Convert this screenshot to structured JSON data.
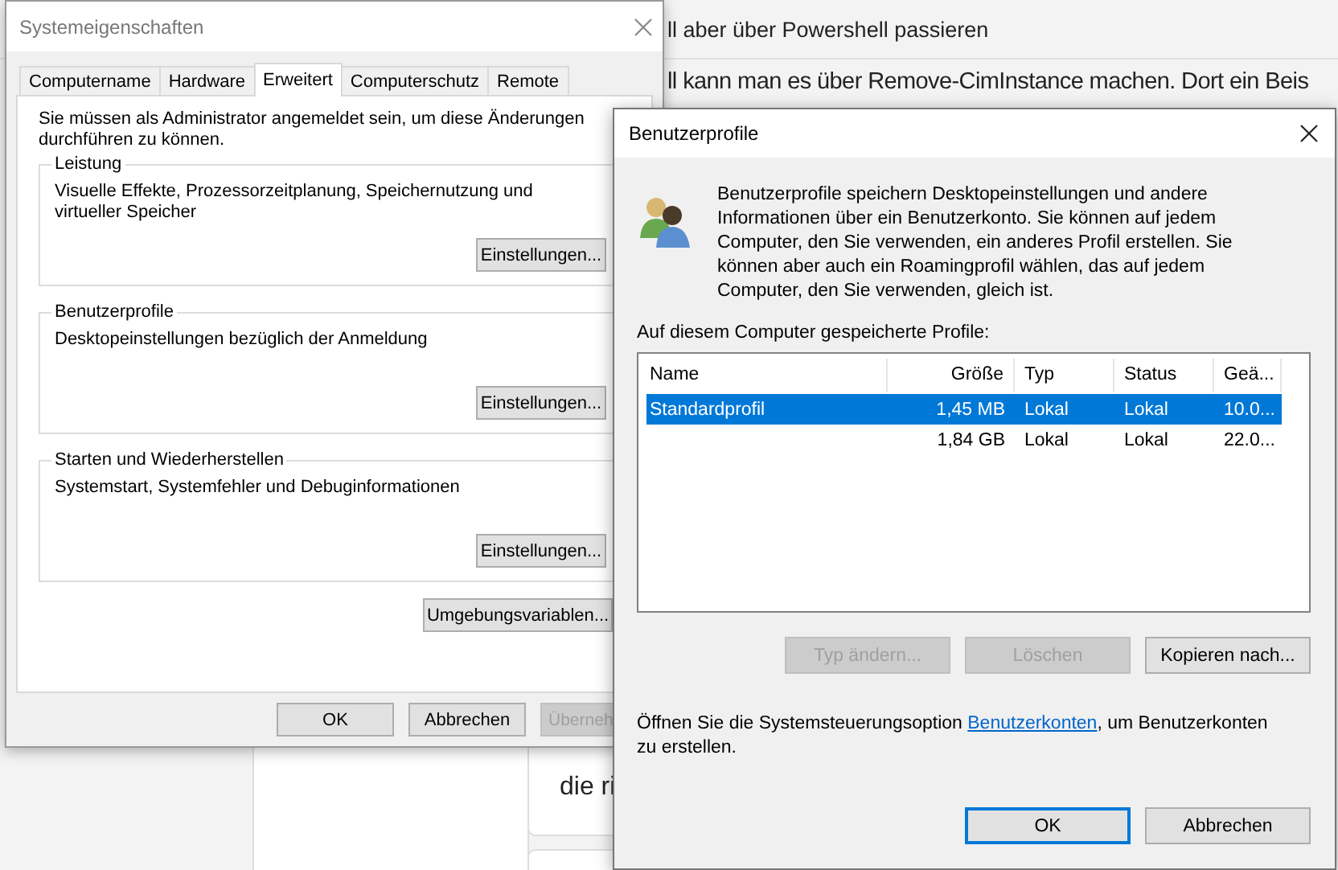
{
  "background_page": {
    "heading_fragment": "ll aber über Powershell passieren",
    "text_fragment": "ll kann man es über Remove-CimInstance machen. Dort ein Beis",
    "card_fragment": "die ri"
  },
  "system_properties": {
    "title": "Systemeigenschaften",
    "tabs": [
      {
        "label": "Computername",
        "selected": false
      },
      {
        "label": "Hardware",
        "selected": false
      },
      {
        "label": "Erweitert",
        "selected": true
      },
      {
        "label": "Computerschutz",
        "selected": false
      },
      {
        "label": "Remote",
        "selected": false
      }
    ],
    "notice": "Sie müssen als Administrator angemeldet sein, um diese Änderungen durchführen zu können.",
    "groups": [
      {
        "title": "Leistung",
        "description": "Visuelle Effekte, Prozessorzeitplanung, Speichernutzung und virtueller Speicher",
        "button": "Einstellungen..."
      },
      {
        "title": "Benutzerprofile",
        "description": "Desktopeinstellungen bezüglich der Anmeldung",
        "button": "Einstellungen..."
      },
      {
        "title": "Starten und Wiederherstellen",
        "description": "Systemstart, Systemfehler und Debuginformationen",
        "button": "Einstellungen..."
      }
    ],
    "environment_button": "Umgebungsvariablen...",
    "buttons": [
      {
        "label": "OK",
        "disabled": false
      },
      {
        "label": "Abbrechen",
        "disabled": false
      },
      {
        "label": "Überneh",
        "disabled": true
      }
    ]
  },
  "user_profiles": {
    "title": "Benutzerprofile",
    "intro": "Benutzerprofile speichern Desktopeinstellungen und andere Informationen über ein Benutzerkonto. Sie können auf jedem Computer, den Sie verwenden, ein anderes Profil erstellen. Sie können aber auch ein Roamingprofil wählen, das auf jedem Computer, den Sie verwenden, gleich ist.",
    "list_label": "Auf diesem Computer gespeicherte Profile:",
    "columns": [
      "Name",
      "Größe",
      "Typ",
      "Status",
      "Geä..."
    ],
    "rows": [
      {
        "name": "Standardprofil",
        "size": "1,45 MB",
        "type": "Lokal",
        "status": "Lokal",
        "changed": "10.0...",
        "selected": true
      },
      {
        "size": "1,84 GB",
        "type": "Lokal",
        "status": "Lokal",
        "changed": "22.0...",
        "selected": false
      }
    ],
    "actions": [
      {
        "label": "Typ ändern...",
        "disabled": true
      },
      {
        "label": "Löschen",
        "disabled": true
      },
      {
        "label": "Kopieren nach...",
        "disabled": false
      }
    ],
    "footer_before": "Öffnen Sie die Systemsteuerungsoption ",
    "footer_link": "Benutzerkonten",
    "footer_after": ", um Benutzerkonten zu erstellen.",
    "buttons": [
      {
        "label": "OK",
        "default": true
      },
      {
        "label": "Abbrechen",
        "default": false
      }
    ]
  }
}
